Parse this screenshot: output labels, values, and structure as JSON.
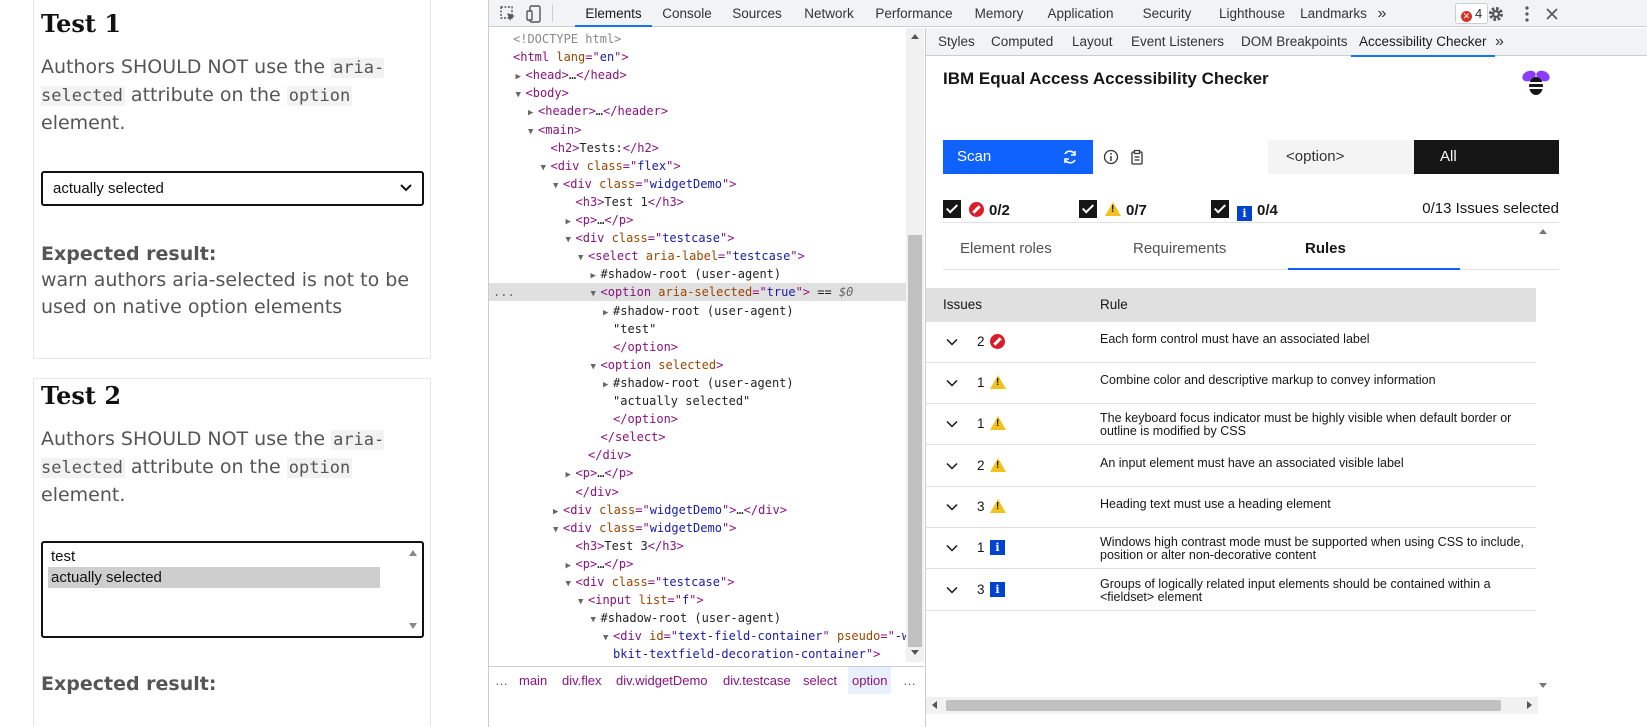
{
  "page": {
    "test1": {
      "heading": "Test 1",
      "para_pre": "Authors SHOULD NOT use the ",
      "code1": "aria-selected",
      "para_mid": " attribute on the ",
      "code2": "option",
      "para_post": " element.",
      "select_value": "actually selected",
      "expected_label": "Expected result:",
      "expected_text": "warn authors aria-selected is not to be used on native option elements"
    },
    "test2": {
      "heading": "Test 2",
      "para_pre": "Authors SHOULD NOT use the ",
      "code1": "aria-selected",
      "para_mid": " attribute on the ",
      "code2": "option",
      "para_post": " element.",
      "options": [
        "test",
        "actually selected"
      ],
      "selected_index": 1,
      "expected_label": "Expected result:"
    }
  },
  "devtools": {
    "tabs": [
      "Elements",
      "Console",
      "Sources",
      "Network",
      "Performance",
      "Memory",
      "Application",
      "Security",
      "Lighthouse",
      "Landmarks"
    ],
    "active_tab": "Elements",
    "more_tabs": "»",
    "error_count": "4",
    "error_icon": "x-icon",
    "tree": [
      {
        "indent": 0,
        "arrow": "",
        "parts": [
          [
            "t-gray",
            "<!DOCTYPE html>"
          ]
        ]
      },
      {
        "indent": 0,
        "arrow": "",
        "parts": [
          [
            "t-tag",
            "<html "
          ],
          [
            "t-attr",
            "lang"
          ],
          [
            "t-tag",
            "=\""
          ],
          [
            "t-val",
            "en"
          ],
          [
            "t-tag",
            "\">"
          ]
        ]
      },
      {
        "indent": 1,
        "arrow": "▶",
        "parts": [
          [
            "t-tag",
            "<head>"
          ],
          [
            "t-text",
            "…"
          ],
          [
            "t-tag",
            "</head>"
          ]
        ]
      },
      {
        "indent": 1,
        "arrow": "▼",
        "parts": [
          [
            "t-tag",
            "<body>"
          ]
        ]
      },
      {
        "indent": 2,
        "arrow": "▶",
        "parts": [
          [
            "t-tag",
            "<header>"
          ],
          [
            "t-text",
            "…"
          ],
          [
            "t-tag",
            "</header>"
          ]
        ]
      },
      {
        "indent": 2,
        "arrow": "▼",
        "parts": [
          [
            "t-tag",
            "<main>"
          ]
        ]
      },
      {
        "indent": 3,
        "arrow": "",
        "parts": [
          [
            "t-tag",
            "<h2>"
          ],
          [
            "t-text",
            "Tests:"
          ],
          [
            "t-tag",
            "</h2>"
          ]
        ]
      },
      {
        "indent": 3,
        "arrow": "▼",
        "parts": [
          [
            "t-tag",
            "<div "
          ],
          [
            "t-attr",
            "class"
          ],
          [
            "t-tag",
            "=\""
          ],
          [
            "t-val",
            "flex"
          ],
          [
            "t-tag",
            "\">"
          ]
        ]
      },
      {
        "indent": 4,
        "arrow": "▼",
        "parts": [
          [
            "t-tag",
            "<div "
          ],
          [
            "t-attr",
            "class"
          ],
          [
            "t-tag",
            "=\""
          ],
          [
            "t-val",
            "widgetDemo"
          ],
          [
            "t-tag",
            "\">"
          ]
        ]
      },
      {
        "indent": 5,
        "arrow": "",
        "parts": [
          [
            "t-tag",
            "<h3>"
          ],
          [
            "t-text",
            "Test 1"
          ],
          [
            "t-tag",
            "</h3>"
          ]
        ]
      },
      {
        "indent": 5,
        "arrow": "▶",
        "parts": [
          [
            "t-tag",
            "<p>"
          ],
          [
            "t-text",
            "…"
          ],
          [
            "t-tag",
            "</p>"
          ]
        ]
      },
      {
        "indent": 5,
        "arrow": "▼",
        "parts": [
          [
            "t-tag",
            "<div "
          ],
          [
            "t-attr",
            "class"
          ],
          [
            "t-tag",
            "=\""
          ],
          [
            "t-val",
            "testcase"
          ],
          [
            "t-tag",
            "\">"
          ]
        ]
      },
      {
        "indent": 6,
        "arrow": "▼",
        "parts": [
          [
            "t-tag",
            "<select "
          ],
          [
            "t-attr",
            "aria-label"
          ],
          [
            "t-tag",
            "=\""
          ],
          [
            "t-val",
            "testcase"
          ],
          [
            "t-tag",
            "\">"
          ]
        ]
      },
      {
        "indent": 7,
        "arrow": "▶",
        "parts": [
          [
            "t-text",
            "#shadow-root (user-agent)"
          ]
        ]
      },
      {
        "indent": 7,
        "arrow": "▼",
        "parts": [
          [
            "t-tag",
            "<option "
          ],
          [
            "t-attr",
            "aria-selected"
          ],
          [
            "t-tag",
            "=\""
          ],
          [
            "t-val",
            "true"
          ],
          [
            "t-tag",
            "\">"
          ],
          [
            "t-text",
            " == "
          ],
          [
            "t-dollar",
            "$0"
          ]
        ],
        "highlight": true
      },
      {
        "indent": 8,
        "arrow": "▶",
        "parts": [
          [
            "t-text",
            "#shadow-root (user-agent)"
          ]
        ]
      },
      {
        "indent": 8,
        "arrow": "",
        "parts": [
          [
            "t-text",
            "\"test\""
          ]
        ]
      },
      {
        "indent": 8,
        "arrow": "",
        "parts": [
          [
            "t-tag",
            "</option>"
          ]
        ]
      },
      {
        "indent": 7,
        "arrow": "▼",
        "parts": [
          [
            "t-tag",
            "<option "
          ],
          [
            "t-attr",
            "selected"
          ],
          [
            "t-tag",
            ">"
          ]
        ]
      },
      {
        "indent": 8,
        "arrow": "▶",
        "parts": [
          [
            "t-text",
            "#shadow-root (user-agent)"
          ]
        ]
      },
      {
        "indent": 8,
        "arrow": "",
        "parts": [
          [
            "t-text",
            "\"actually selected\""
          ]
        ]
      },
      {
        "indent": 8,
        "arrow": "",
        "parts": [
          [
            "t-tag",
            "</option>"
          ]
        ]
      },
      {
        "indent": 7,
        "arrow": "",
        "parts": [
          [
            "t-tag",
            "</select>"
          ]
        ]
      },
      {
        "indent": 6,
        "arrow": "",
        "parts": [
          [
            "t-tag",
            "</div>"
          ]
        ]
      },
      {
        "indent": 5,
        "arrow": "▶",
        "parts": [
          [
            "t-tag",
            "<p>"
          ],
          [
            "t-text",
            "…"
          ],
          [
            "t-tag",
            "</p>"
          ]
        ]
      },
      {
        "indent": 5,
        "arrow": "",
        "parts": [
          [
            "t-tag",
            "</div>"
          ]
        ]
      },
      {
        "indent": 4,
        "arrow": "▶",
        "parts": [
          [
            "t-tag",
            "<div "
          ],
          [
            "t-attr",
            "class"
          ],
          [
            "t-tag",
            "=\""
          ],
          [
            "t-val",
            "widgetDemo"
          ],
          [
            "t-tag",
            "\">"
          ],
          [
            "t-text",
            "…"
          ],
          [
            "t-tag",
            "</div>"
          ]
        ]
      },
      {
        "indent": 4,
        "arrow": "▼",
        "parts": [
          [
            "t-tag",
            "<div "
          ],
          [
            "t-attr",
            "class"
          ],
          [
            "t-tag",
            "=\""
          ],
          [
            "t-val",
            "widgetDemo"
          ],
          [
            "t-tag",
            "\">"
          ]
        ]
      },
      {
        "indent": 5,
        "arrow": "",
        "parts": [
          [
            "t-tag",
            "<h3>"
          ],
          [
            "t-text",
            "Test 3"
          ],
          [
            "t-tag",
            "</h3>"
          ]
        ]
      },
      {
        "indent": 5,
        "arrow": "▶",
        "parts": [
          [
            "t-tag",
            "<p>"
          ],
          [
            "t-text",
            "…"
          ],
          [
            "t-tag",
            "</p>"
          ]
        ]
      },
      {
        "indent": 5,
        "arrow": "▼",
        "parts": [
          [
            "t-tag",
            "<div "
          ],
          [
            "t-attr",
            "class"
          ],
          [
            "t-tag",
            "=\""
          ],
          [
            "t-val",
            "testcase"
          ],
          [
            "t-tag",
            "\">"
          ]
        ]
      },
      {
        "indent": 6,
        "arrow": "▼",
        "parts": [
          [
            "t-tag",
            "<input "
          ],
          [
            "t-attr",
            "list"
          ],
          [
            "t-tag",
            "=\""
          ],
          [
            "t-val",
            "f"
          ],
          [
            "t-tag",
            "\">"
          ]
        ]
      },
      {
        "indent": 7,
        "arrow": "▼",
        "parts": [
          [
            "t-text",
            "#shadow-root (user-agent)"
          ]
        ]
      },
      {
        "indent": 8,
        "arrow": "▼",
        "parts": [
          [
            "t-tag",
            "<div "
          ],
          [
            "t-attr",
            "id"
          ],
          [
            "t-tag",
            "=\""
          ],
          [
            "t-val",
            "text-field-container"
          ],
          [
            "t-tag",
            "\" "
          ],
          [
            "t-attr",
            "pseudo"
          ],
          [
            "t-tag",
            "=\""
          ],
          [
            "t-val",
            "-we"
          ]
        ]
      },
      {
        "indent": 8,
        "arrow": "",
        "parts": [
          [
            "t-val",
            "bkit-textfield-decoration-container"
          ],
          [
            "t-tag",
            "\">"
          ]
        ]
      }
    ],
    "ellipsis": "...",
    "breadcrumbs": [
      "main",
      "div.flex",
      "div.widgetDemo",
      "div.testcase",
      "select",
      "option"
    ],
    "breadcrumb_more": "…",
    "breadcrumb_lead": "…",
    "sidebar_tabs": [
      "Styles",
      "Computed",
      "Layout",
      "Event Listeners",
      "DOM Breakpoints",
      "Accessibility Checker"
    ],
    "sidebar_active": "Accessibility Checker",
    "sidebar_more": "»"
  },
  "checker": {
    "title": "IBM Equal Access Accessibility Checker",
    "scan_label": "Scan",
    "target": "<option>",
    "scope": "All",
    "filters": [
      {
        "icon": "error",
        "label": "0/2"
      },
      {
        "icon": "warning",
        "label": "0/7"
      },
      {
        "icon": "info",
        "label": "0/4"
      }
    ],
    "selected_summary": "0/13 Issues selected",
    "view_tabs": [
      "Element roles",
      "Requirements",
      "Rules"
    ],
    "active_view": "Rules",
    "columns": {
      "issues": "Issues",
      "rule": "Rule"
    },
    "rows": [
      {
        "count": "2",
        "severity": "error",
        "rule": "Each form control must have an associated label"
      },
      {
        "count": "1",
        "severity": "warning",
        "rule": "Combine color and descriptive markup to convey information"
      },
      {
        "count": "1",
        "severity": "warning",
        "rule": "The keyboard focus indicator must be highly visible when default border or outline is modified by CSS"
      },
      {
        "count": "2",
        "severity": "warning",
        "rule": "An input element must have an associated visible label"
      },
      {
        "count": "3",
        "severity": "warning",
        "rule": "Heading text must use a heading element"
      },
      {
        "count": "1",
        "severity": "info",
        "rule": "Windows high contrast mode must be supported when using CSS to include, position or alter non-decorative content"
      },
      {
        "count": "3",
        "severity": "info",
        "rule": "Groups of logically related input elements should be contained within a <fieldset> element"
      }
    ],
    "info_char": "i",
    "colors": {
      "scan": "#0f62fe",
      "error": "#da1e28",
      "warning": "#f1c21b",
      "info": "#0043ce"
    }
  }
}
